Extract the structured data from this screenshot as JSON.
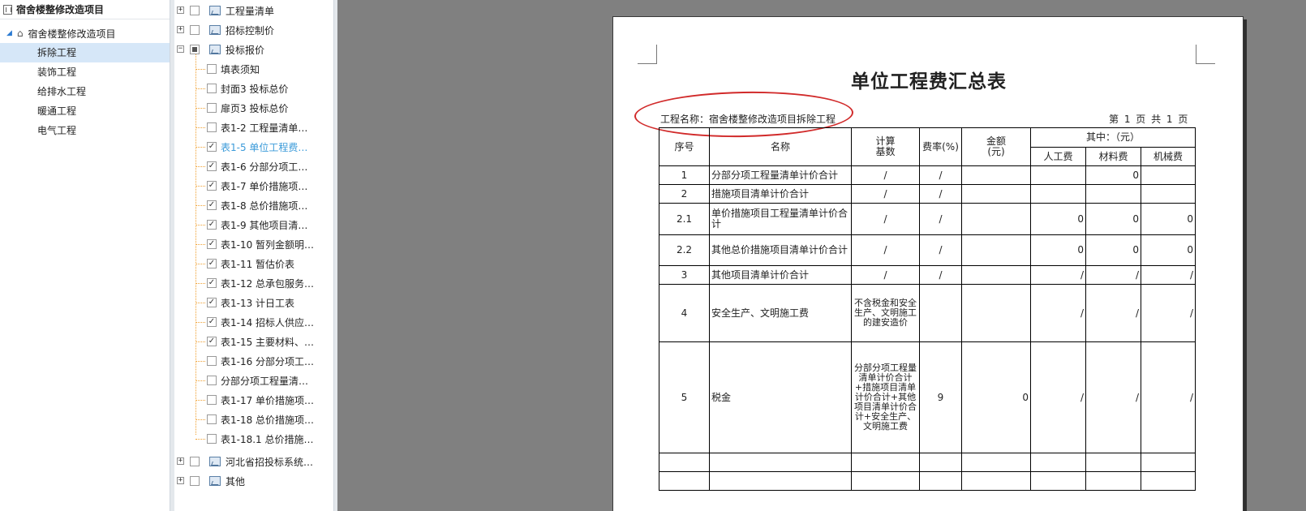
{
  "project_panel": {
    "root_title": "宿舍楼整修改造项目",
    "project_node": "宿舍楼整修改造项目",
    "units": [
      "拆除工程",
      "装饰工程",
      "给排水工程",
      "暖通工程",
      "电气工程"
    ]
  },
  "report_tree": {
    "top_groups": [
      "工程量清单",
      "招标控制价",
      "投标报价"
    ],
    "items": [
      {
        "label": "填表须知",
        "checked": false,
        "active": false
      },
      {
        "label": "封面3 投标总价",
        "checked": false,
        "active": false
      },
      {
        "label": "扉页3 投标总价",
        "checked": false,
        "active": false
      },
      {
        "label": "表1-2 工程量清单…",
        "checked": false,
        "active": false
      },
      {
        "label": "表1-5 单位工程费…",
        "checked": true,
        "active": true
      },
      {
        "label": "表1-6 分部分项工…",
        "checked": true,
        "active": false
      },
      {
        "label": "表1-7 单价措施项…",
        "checked": true,
        "active": false
      },
      {
        "label": "表1-8 总价措施项…",
        "checked": true,
        "active": false
      },
      {
        "label": "表1-9 其他项目清…",
        "checked": true,
        "active": false
      },
      {
        "label": "表1-10 暂列金额明…",
        "checked": true,
        "active": false
      },
      {
        "label": "表1-11 暂估价表",
        "checked": true,
        "active": false
      },
      {
        "label": "表1-12 总承包服务…",
        "checked": true,
        "active": false
      },
      {
        "label": "表1-13 计日工表",
        "checked": true,
        "active": false
      },
      {
        "label": "表1-14 招标人供应…",
        "checked": true,
        "active": false
      },
      {
        "label": "表1-15 主要材料、…",
        "checked": true,
        "active": false
      },
      {
        "label": "表1-16 分部分项工…",
        "checked": false,
        "active": false
      },
      {
        "label": "分部分项工程量清…",
        "checked": false,
        "active": false
      },
      {
        "label": "表1-17 单价措施项…",
        "checked": false,
        "active": false
      },
      {
        "label": "表1-18 总价措施项…",
        "checked": false,
        "active": false
      },
      {
        "label": "表1-18.1 总价措施…",
        "checked": false,
        "active": false
      }
    ],
    "bottom_groups": [
      "河北省招投标系统…",
      "其他"
    ]
  },
  "report": {
    "title": "单位工程费汇总表",
    "project_label": "工程名称：宿舍楼整修改造项目拆除工程",
    "page_info": "第 1 页  共 1 页",
    "headers": {
      "seq": "序号",
      "name": "名称",
      "base": [
        "计算",
        "基数"
      ],
      "rate": "费率(%)",
      "amount": [
        "金额",
        "(元)"
      ],
      "of_which": "其中：（元）",
      "labor": "人工费",
      "material": "材料费",
      "machine": "机械费"
    },
    "rows": [
      {
        "seq": "1",
        "name": "分部分项工程量清单计价合计",
        "base": "/",
        "rate": "/",
        "amount": "",
        "labor": "",
        "material": "0",
        "machine": ""
      },
      {
        "seq": "2",
        "name": "措施项目清单计价合计",
        "base": "/",
        "rate": "/",
        "amount": "",
        "labor": "",
        "material": "",
        "machine": ""
      },
      {
        "seq": "2.1",
        "name": "单价措施项目工程量清单计价合计",
        "base": "/",
        "rate": "/",
        "amount": "",
        "labor": "0",
        "material": "0",
        "machine": "0"
      },
      {
        "seq": "2.2",
        "name": "其他总价措施项目清单计价合计",
        "base": "/",
        "rate": "/",
        "amount": "",
        "labor": "0",
        "material": "0",
        "machine": "0"
      },
      {
        "seq": "3",
        "name": "其他项目清单计价合计",
        "base": "/",
        "rate": "/",
        "amount": "",
        "labor": "/",
        "material": "/",
        "machine": "/"
      },
      {
        "seq": "4",
        "name": "安全生产、文明施工费",
        "base": "不含税金和安全生产、文明施工的建安造价",
        "rate": "",
        "amount": "",
        "labor": "/",
        "material": "/",
        "machine": "/"
      },
      {
        "seq": "5",
        "name": "税金",
        "base": "分部分项工程量清单计价合计+措施项目清单计价合计+其他项目清单计价合计+安全生产、文明施工费",
        "rate": "9",
        "amount": "0",
        "labor": "/",
        "material": "/",
        "machine": "/"
      }
    ]
  }
}
